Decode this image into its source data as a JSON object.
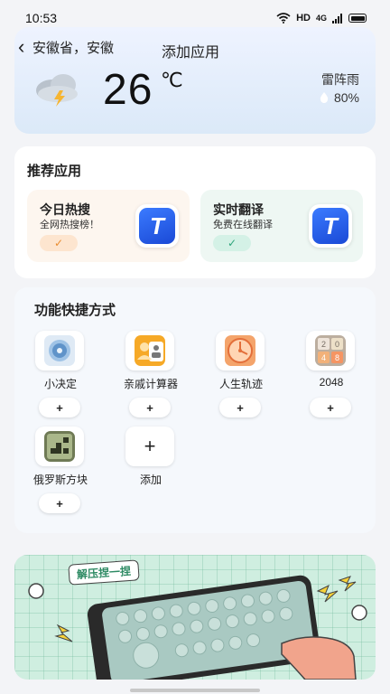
{
  "status_bar": {
    "time": "10:53",
    "network": "HD",
    "signal": "4G"
  },
  "header": {
    "location": "安徽省，安徽",
    "title": "添加应用"
  },
  "weather": {
    "temperature": "26",
    "unit": "℃",
    "condition": "雷阵雨",
    "humidity": "80%",
    "icon": "thunderstorm-cloud-icon"
  },
  "recommended": {
    "title": "推荐应用",
    "items": [
      {
        "title": "今日热搜",
        "subtitle": "全网热搜榜！",
        "check": "✓",
        "icon": "translate-t-icon"
      },
      {
        "title": "实时翻译",
        "subtitle": "免费在线翻译",
        "check": "✓",
        "icon": "translate-t-icon"
      }
    ]
  },
  "shortcuts": {
    "title": "功能快捷方式",
    "add_symbol": "+",
    "items": [
      {
        "label": "小决定",
        "icon": "decision-wheel-icon"
      },
      {
        "label": "亲戚计算器",
        "icon": "relative-calculator-icon"
      },
      {
        "label": "人生轨迹",
        "icon": "life-clock-icon"
      },
      {
        "label": "2048",
        "icon": "tile-2048-icon",
        "tiles": [
          "2",
          "0",
          "4",
          "8"
        ]
      },
      {
        "label": "俄罗斯方块",
        "icon": "tetris-icon"
      }
    ],
    "add_tile": {
      "label": "添加",
      "symbol": "+"
    }
  },
  "banner": {
    "tag": "解压捏一捏"
  },
  "colors": {
    "accent_blue": "#2a5fe8",
    "orange": "#e98c30",
    "green": "#2ea57b"
  }
}
